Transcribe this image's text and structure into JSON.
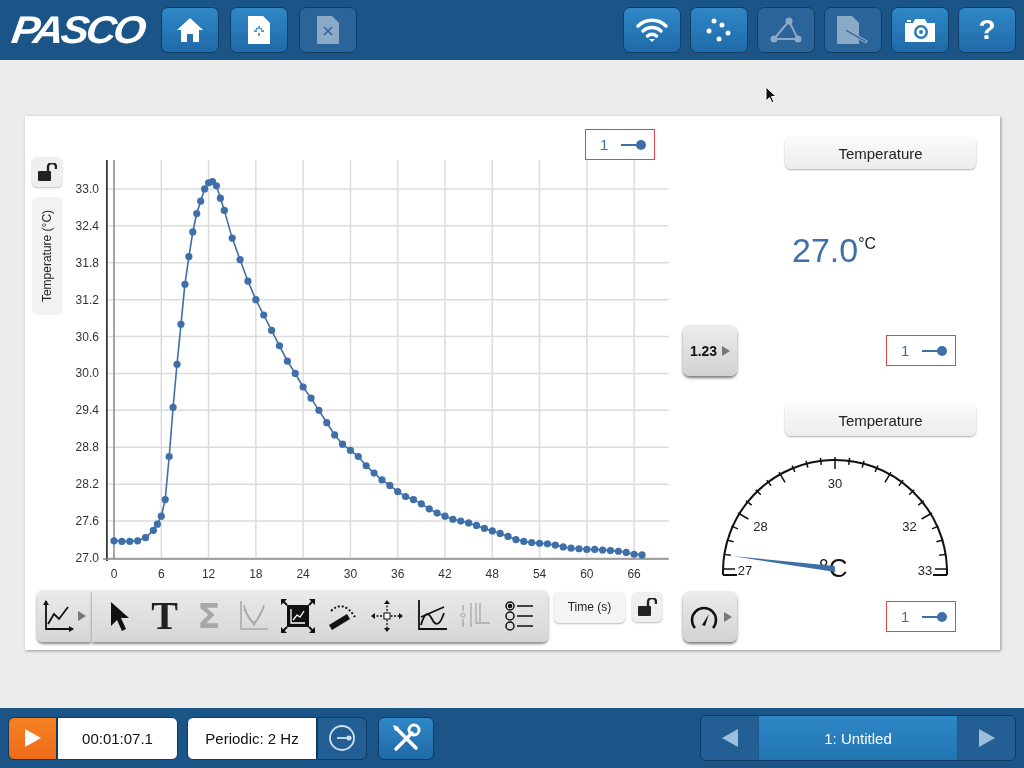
{
  "header": {
    "logo": "PASCO",
    "left_buttons": [
      {
        "disabled": false
      },
      {
        "disabled": false
      },
      {
        "disabled": true
      }
    ],
    "right_buttons": [
      {
        "disabled": false
      },
      {
        "disabled": false
      },
      {
        "disabled": true
      },
      {
        "disabled": true
      },
      {
        "disabled": false
      },
      {
        "label": "?",
        "disabled": false
      }
    ]
  },
  "graph": {
    "chart_data": {
      "type": "line",
      "grid": true,
      "xlabel": "Time (s)",
      "ylabel": "Temperature (°C)",
      "xlim": [
        -0.9,
        70.4
      ],
      "ylim": [
        27,
        33.47
      ],
      "xticks": [
        0,
        6,
        12,
        18,
        24,
        30,
        36,
        42,
        48,
        54,
        60,
        66
      ],
      "yticks": [
        {
          "value": 27,
          "label": "27.0"
        },
        {
          "value": 27.6,
          "label": "27.6"
        },
        {
          "value": 28.2,
          "label": "28.2"
        },
        {
          "value": 28.8,
          "label": "28.8"
        },
        {
          "value": 29.4,
          "label": "29.4"
        },
        {
          "value": 30,
          "label": "30.0"
        },
        {
          "value": 30.6,
          "label": "30.6"
        },
        {
          "value": 31.2,
          "label": "31.2"
        },
        {
          "value": 31.8,
          "label": "31.8"
        },
        {
          "value": 32.4,
          "label": "32.4"
        },
        {
          "value": 33,
          "label": "33.0"
        }
      ],
      "x": [
        0,
        1,
        2,
        3,
        4,
        5,
        5.5,
        6,
        6.5,
        7,
        7.5,
        8,
        8.5,
        9,
        9.5,
        10,
        10.5,
        11,
        11.5,
        12,
        12.5,
        13,
        13.5,
        14,
        15,
        16,
        17,
        18,
        19,
        20,
        21,
        22,
        23,
        24,
        25,
        26,
        27,
        28,
        29,
        30,
        31,
        32,
        33,
        34,
        35,
        36,
        37,
        38,
        39,
        40,
        41,
        42,
        43,
        44,
        45,
        46,
        47,
        48,
        49,
        50,
        51,
        52,
        53,
        54,
        55,
        56,
        57,
        58,
        59,
        60,
        61,
        62,
        63,
        64,
        65,
        66,
        67
      ],
      "series": [
        {
          "name": "1",
          "color": "#3e6fa8",
          "marker": true,
          "values": [
            27.28,
            27.27,
            27.27,
            27.28,
            27.33,
            27.45,
            27.55,
            27.68,
            27.95,
            28.65,
            29.45,
            30.15,
            30.8,
            31.45,
            31.9,
            32.3,
            32.6,
            32.8,
            33.0,
            33.1,
            33.12,
            33.05,
            32.85,
            32.65,
            32.2,
            31.85,
            31.5,
            31.2,
            30.95,
            30.7,
            30.45,
            30.2,
            30.0,
            29.78,
            29.6,
            29.4,
            29.2,
            29.0,
            28.85,
            28.75,
            28.65,
            28.5,
            28.38,
            28.27,
            28.18,
            28.08,
            28.0,
            27.95,
            27.88,
            27.8,
            27.73,
            27.68,
            27.63,
            27.6,
            27.57,
            27.53,
            27.48,
            27.44,
            27.4,
            27.35,
            27.3,
            27.27,
            27.25,
            27.24,
            27.23,
            27.21,
            27.18,
            27.16,
            27.15,
            27.14,
            27.14,
            27.13,
            27.12,
            27.11,
            27.09,
            27.06,
            27.05
          ]
        }
      ]
    },
    "tools": [
      {
        "disabled": false
      },
      {
        "label": "T",
        "disabled": false
      },
      {
        "label": "Σ",
        "disabled": true
      },
      {
        "disabled": true
      },
      {
        "disabled": false
      },
      {
        "disabled": false
      },
      {
        "disabled": false
      },
      {
        "disabled": false
      },
      {
        "disabled": true
      },
      {
        "disabled": false
      }
    ]
  },
  "digits": {
    "title": "Temperature",
    "value": "27.0",
    "unit": "°C",
    "button": "1.23",
    "legend": "1"
  },
  "meter": {
    "title": "Temperature",
    "ticks": [
      "27",
      "28",
      "30",
      "32",
      "33"
    ],
    "unit": "°C",
    "level": 0.04,
    "legend": "1"
  },
  "footer": {
    "time": "00:01:07.1",
    "sampling": "Periodic: 2 Hz",
    "page": "1: Untitled"
  }
}
